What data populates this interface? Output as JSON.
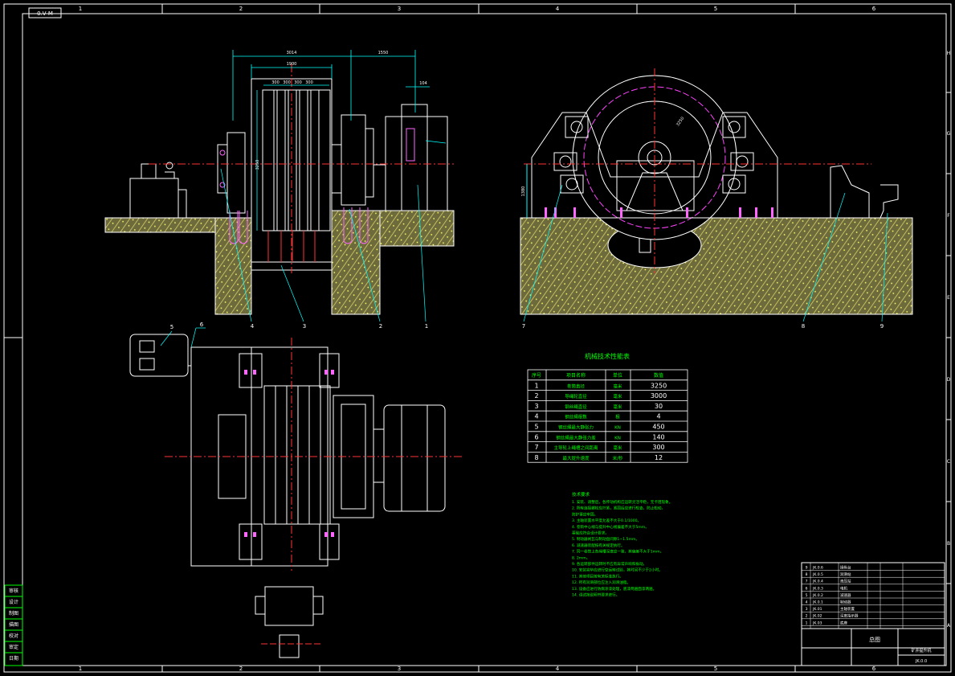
{
  "title_corner": "0.V M",
  "border": {
    "columns": [
      "1",
      "2",
      "3",
      "4",
      "5",
      "6"
    ],
    "rows": [
      "A",
      "B",
      "C",
      "D",
      "E",
      "F",
      "G",
      "H"
    ]
  },
  "dimensions": {
    "overall_width": "3014",
    "drum_width": "1900",
    "segments": [
      "300",
      "300",
      "300",
      "300"
    ],
    "right_span": "1550",
    "shaft_offset": "104",
    "drum_diameter": "3250",
    "left_height": "1380",
    "wheel_dia": "3250"
  },
  "callouts": [
    "4",
    "3",
    "2",
    "1",
    "5",
    "6",
    "7",
    "8",
    "9"
  ],
  "table": {
    "title": "机械技术性能表",
    "headers": [
      "序号",
      "项目名称",
      "单位",
      "数值"
    ],
    "rows": [
      {
        "no": "1",
        "name": "卷筒直径",
        "unit": "毫米",
        "value": "3250"
      },
      {
        "no": "2",
        "name": "导绳轮直径",
        "unit": "毫米",
        "value": "3000"
      },
      {
        "no": "3",
        "name": "钢丝绳直径",
        "unit": "毫米",
        "value": "30"
      },
      {
        "no": "4",
        "name": "钢丝绳根数",
        "unit": "根",
        "value": "4"
      },
      {
        "no": "5",
        "name": "钢丝绳最大静张力",
        "unit": "KN",
        "value": "450"
      },
      {
        "no": "6",
        "name": "钢丝绳最大静张力差",
        "unit": "KN",
        "value": "140"
      },
      {
        "no": "7",
        "name": "主导轮上绳槽之间距离",
        "unit": "毫米",
        "value": "300"
      },
      {
        "no": "8",
        "name": "最大提升速度",
        "unit": "米/秒",
        "value": "12"
      }
    ]
  },
  "notes": {
    "title": "技术要求",
    "lines": [
      "1. 安装、调整后，各传动机构应运转灵活平稳，无卡阻现象。",
      "2. 所有连接螺栓应拧紧，紧固后应进行检查，防止松动。",
      "   防护罩应牢固。",
      "3. 主轴装置水平度允差不大于0.1/1000。",
      "4. 卷筒中心线与提升中心线偏差不大于5mm。",
      "   基础应符合设计要求。",
      "5. 制动器闸瓦与制动盘间隙1~1.5mm。",
      "6. 减速器装配按有关规定执行。",
      "7. 同一卷筒上各绳槽深度应一致，其偏差不大于1mm。",
      "8. 2mm。",
      "9. 各运转部件运转时不应有异常声响和振动。",
      "10. 安装完毕应进行空运转试验，其时间不少于2小时。",
      "11. 其他项目按有关标准执行。",
      "12. 所有润滑部位应注入润滑油脂。",
      "13. 设备应进行防腐涂漆处理，底漆两遍面漆两遍。",
      "14. 调试按说明书要求进行。"
    ]
  },
  "left_stamp": [
    "审核",
    "设计",
    "制图",
    "描图",
    "校对",
    "审定",
    "日期"
  ],
  "title_block": {
    "parts": [
      {
        "no": "9",
        "code": "JK.0.6",
        "name": "操纵台"
      },
      {
        "no": "8",
        "code": "JK.0.5",
        "name": "润滑站"
      },
      {
        "no": "7",
        "code": "JK.0.4",
        "name": "液压站"
      },
      {
        "no": "6",
        "code": "JK.0.3",
        "name": "电机"
      },
      {
        "no": "5",
        "code": "JK.0.2",
        "name": "减速器"
      },
      {
        "no": "4",
        "code": "JK.0.1",
        "name": "制动器"
      },
      {
        "no": "3",
        "code": "JK.01",
        "name": "主轴装置"
      },
      {
        "no": "2",
        "code": "JK.02",
        "name": "深度指示器"
      },
      {
        "no": "1",
        "code": "JK.03",
        "name": "底座"
      }
    ],
    "drawing_title": "总图",
    "company": "矿井提升机",
    "drawing_no": "JK.0.0"
  }
}
